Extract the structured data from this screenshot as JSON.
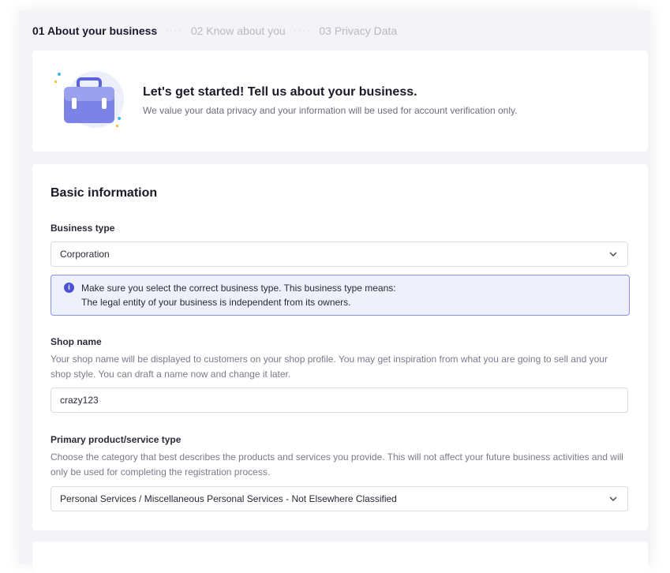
{
  "stepper": {
    "steps": [
      {
        "label": "01 About your business"
      },
      {
        "label": "02 Know about you"
      },
      {
        "label": "03 Privacy Data"
      }
    ],
    "separator": "····"
  },
  "intro": {
    "illustration_icon": "briefcase-icon",
    "title": "Let's get started! Tell us about your business.",
    "subtitle": "We value your data privacy and your information will be used for account verification only."
  },
  "basic": {
    "title": "Basic information",
    "business_type": {
      "label": "Business type",
      "value": "Corporation",
      "notice_icon": "info-icon",
      "notice_line1": "Make sure you select the correct business type. This business type means:",
      "notice_line2": "The legal entity of your business is independent from its owners."
    },
    "shop_name": {
      "label": "Shop name",
      "help": "Your shop name will be displayed to customers on your shop profile. You may get inspiration from what you are going to sell and your shop style. You can draft a name now and change it later.",
      "value": "crazy123"
    },
    "product_type": {
      "label": "Primary product/service type",
      "help": "Choose the category that best describes the products and services you provide. This will not affect your future business activities and will only be used for completing the registration process.",
      "value": "Personal Services / Miscellaneous Personal Services - Not Elsewhere Classified"
    }
  },
  "colors": {
    "accent": "#4c54d6",
    "notice_bg": "#eef0fb",
    "notice_border": "#8a91e2",
    "page_bg": "#f4f4f8"
  }
}
